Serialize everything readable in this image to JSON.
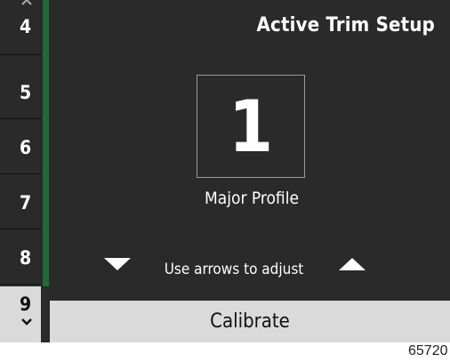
{
  "sidebar": {
    "items": [
      {
        "label": "4"
      },
      {
        "label": "5"
      },
      {
        "label": "6"
      },
      {
        "label": "7"
      },
      {
        "label": "8"
      },
      {
        "label": "9"
      }
    ],
    "scroll_up_icon": "chevron-up",
    "scroll_down_icon": "chevron-down"
  },
  "header": {
    "title": "Active Trim Setup"
  },
  "main": {
    "value": "1",
    "value_label": "Major Profile",
    "hint": "Use arrows to adjust",
    "decrease_icon": "triangle-down",
    "increase_icon": "triangle-up"
  },
  "footer": {
    "calibrate_label": "Calibrate"
  },
  "figure_id": "65720",
  "colors": {
    "background": "#2a2a2a",
    "accent": "#1e6b3a",
    "bar": "#dadada",
    "text": "#ffffff"
  }
}
